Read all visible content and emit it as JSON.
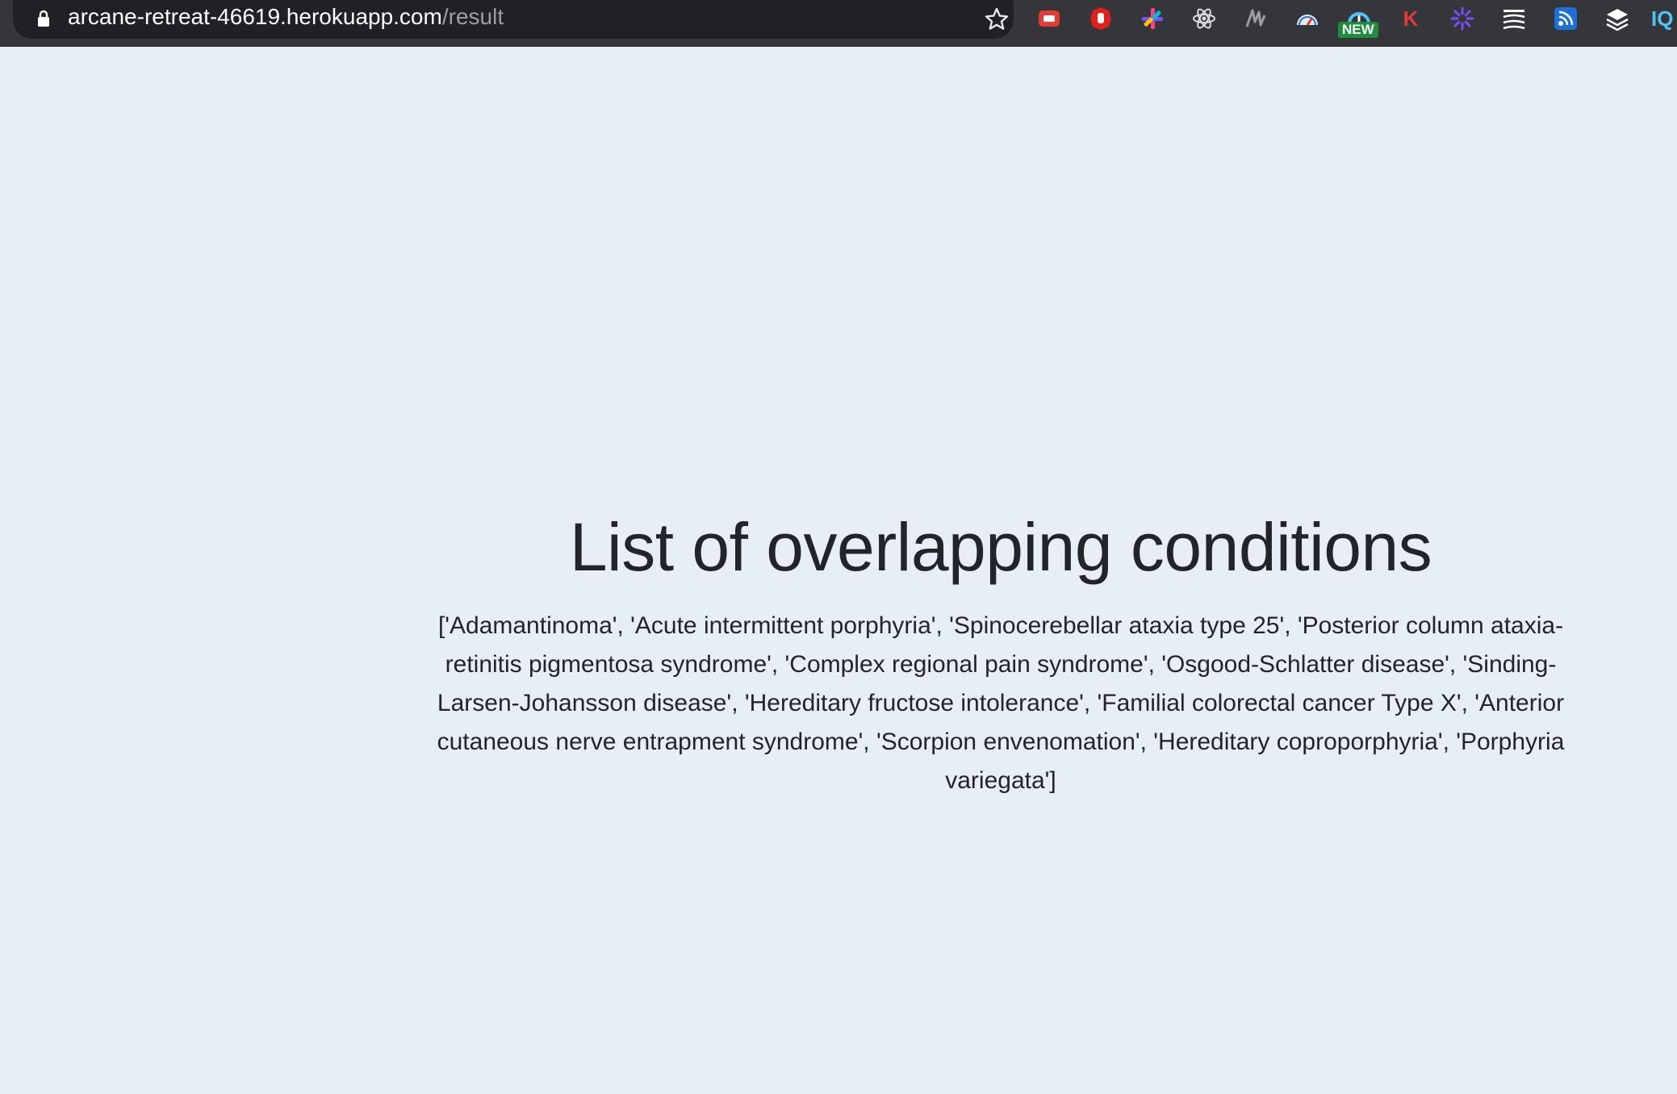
{
  "browser": {
    "url_host": "arcane-retreat-46619.herokuapp.com",
    "url_path": "/result",
    "new_badge": "NEW",
    "k_ext_label": "K",
    "iq_label": "IQ"
  },
  "page": {
    "title": "List of overlapping conditions",
    "conditions_text": "['Adamantinoma', 'Acute intermittent porphyria', 'Spinocerebellar ataxia type 25', 'Posterior column ataxia-retinitis pigmentosa syndrome', 'Complex regional pain syndrome', 'Osgood-Schlatter disease', 'Sinding-Larsen-Johansson disease', 'Hereditary fructose intolerance', 'Familial colorectal cancer Type X', 'Anterior cutaneous nerve entrapment syndrome', 'Scorpion envenomation', 'Hereditary coproporphyria', 'Porphyria variegata']"
  },
  "colors": {
    "page_background": "#e8eef5",
    "text": "#212529",
    "toolbar": "#35363a",
    "omnibox": "#202124"
  }
}
